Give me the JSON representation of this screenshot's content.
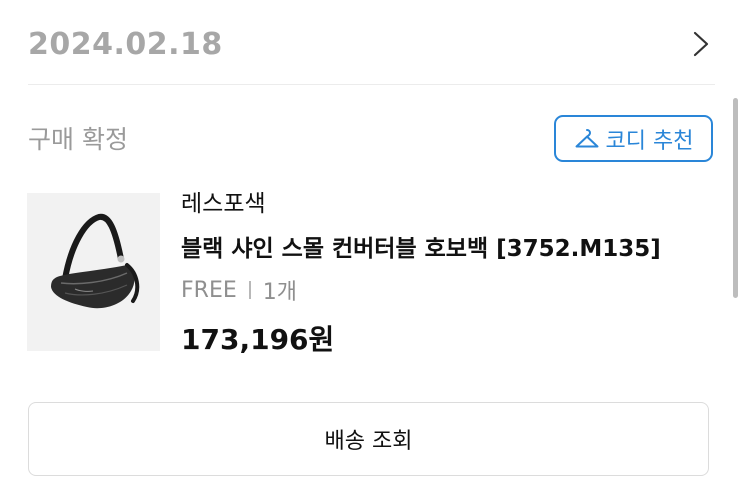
{
  "order": {
    "date": "2024.02.18",
    "status": "구매 확정"
  },
  "buttons": {
    "style_recommend": "코디 추천",
    "track_delivery": "배송 조회"
  },
  "product": {
    "brand": "레스포색",
    "name": "블랙 샤인 스몰 컨버터블 호보백 [3752.M135]",
    "option": "FREE",
    "quantity": "1개",
    "price": "173,196원",
    "image_icon": "black-hobo-bag"
  },
  "icons": {
    "chevron": "chevron-right-icon",
    "hanger": "hanger-icon"
  },
  "colors": {
    "accent": "#2a86d8",
    "muted_text": "#a7a7a7",
    "border": "#dcdcdc"
  }
}
